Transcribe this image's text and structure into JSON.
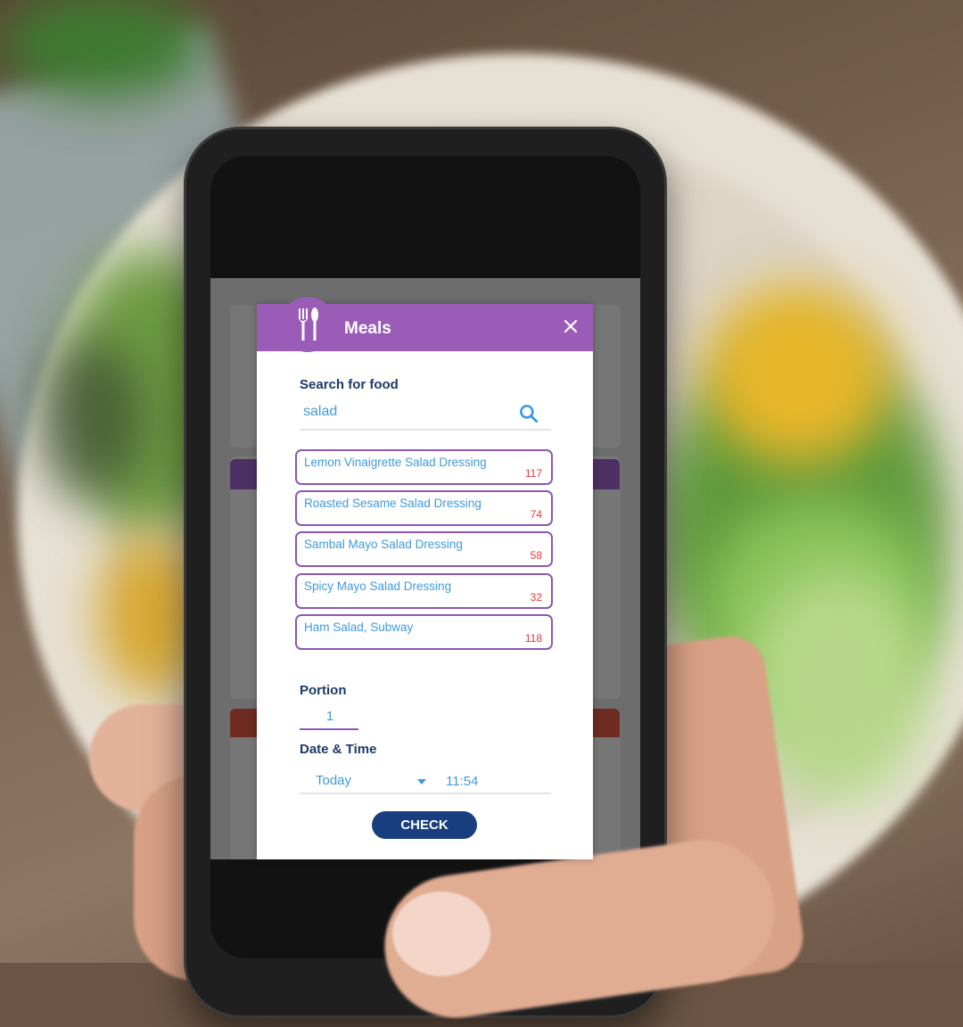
{
  "dialog": {
    "title": "Meals",
    "icon": "fork-spoon-icon",
    "close_icon": "close-icon"
  },
  "search": {
    "label": "Search for food",
    "value": "salad",
    "icon": "search-icon"
  },
  "results": [
    {
      "name": "Lemon Vinaigrette Salad Dressing",
      "calories": "117"
    },
    {
      "name": "Roasted Sesame Salad Dressing",
      "calories": "74"
    },
    {
      "name": "Sambal Mayo Salad Dressing",
      "calories": "58"
    },
    {
      "name": "Spicy Mayo Salad Dressing",
      "calories": "32"
    },
    {
      "name": "Ham Salad, Subway",
      "calories": "118"
    }
  ],
  "portion": {
    "label": "Portion",
    "value": "1"
  },
  "datetime": {
    "label": "Date & Time",
    "date_value": "Today",
    "time_value": "11:54"
  },
  "actions": {
    "check_label": "CHECK"
  },
  "colors": {
    "header_purple": "#9b5cb8",
    "result_border": "#8e56b6",
    "text_blue": "#3e9ae0",
    "label_navy": "#1d3a67",
    "calorie_red": "#e53935",
    "button_navy": "#183e80"
  }
}
